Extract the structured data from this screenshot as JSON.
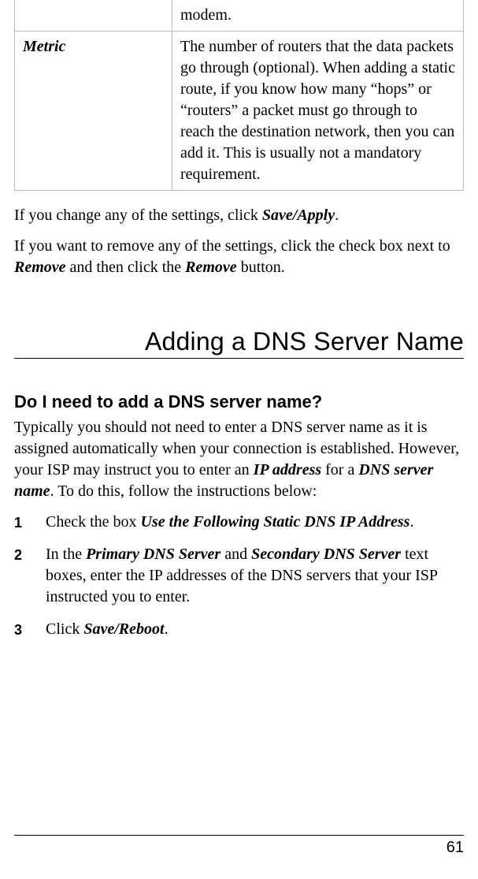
{
  "table": {
    "row0": {
      "desc": "modem."
    },
    "row1": {
      "term": "Metric",
      "desc": "The number of routers that the data packets go through (optional). When adding a static route, if you know how many “hops” or “routers” a packet must go through to reach the destination network, then you can add it. This is usually not a mandatory requirement."
    }
  },
  "paragraph1": {
    "prefix": "If you change any of the settings, click ",
    "bold1": "Save/Apply",
    "suffix": "."
  },
  "paragraph2": {
    "p1": "If you want to remove any of the settings, click the check box next to ",
    "b1": "Remove",
    "p2": " and then click the ",
    "b2": "Remove",
    "p3": " button."
  },
  "section_title": "Adding a DNS Server Name",
  "sub_heading": "Do I need to add a DNS server name?",
  "intro": {
    "p1": "Typically you should not need to enter a DNS server name as it is assigned automatically when your connection is established. However, your ISP may instruct you to enter an ",
    "b1": "IP address",
    "p2": " for a ",
    "b2": "DNS server name",
    "p3": ".  To do this, follow the instructions below:"
  },
  "steps": {
    "s1": {
      "num": "1",
      "p1": "Check  the box ",
      "b1": "Use the Following Static DNS IP Address",
      "p2": "."
    },
    "s2": {
      "num": "2",
      "p1": "In the ",
      "b1": "Primary DNS Server",
      "p2": " and ",
      "b2": "Secondary DNS Server",
      "p3": " text boxes, enter the IP addresses of the DNS servers that your ISP instructed you to enter."
    },
    "s3": {
      "num": "3",
      "p1": "Click ",
      "b1": "Save/Reboot",
      "p2": "."
    }
  },
  "page_number": "61"
}
